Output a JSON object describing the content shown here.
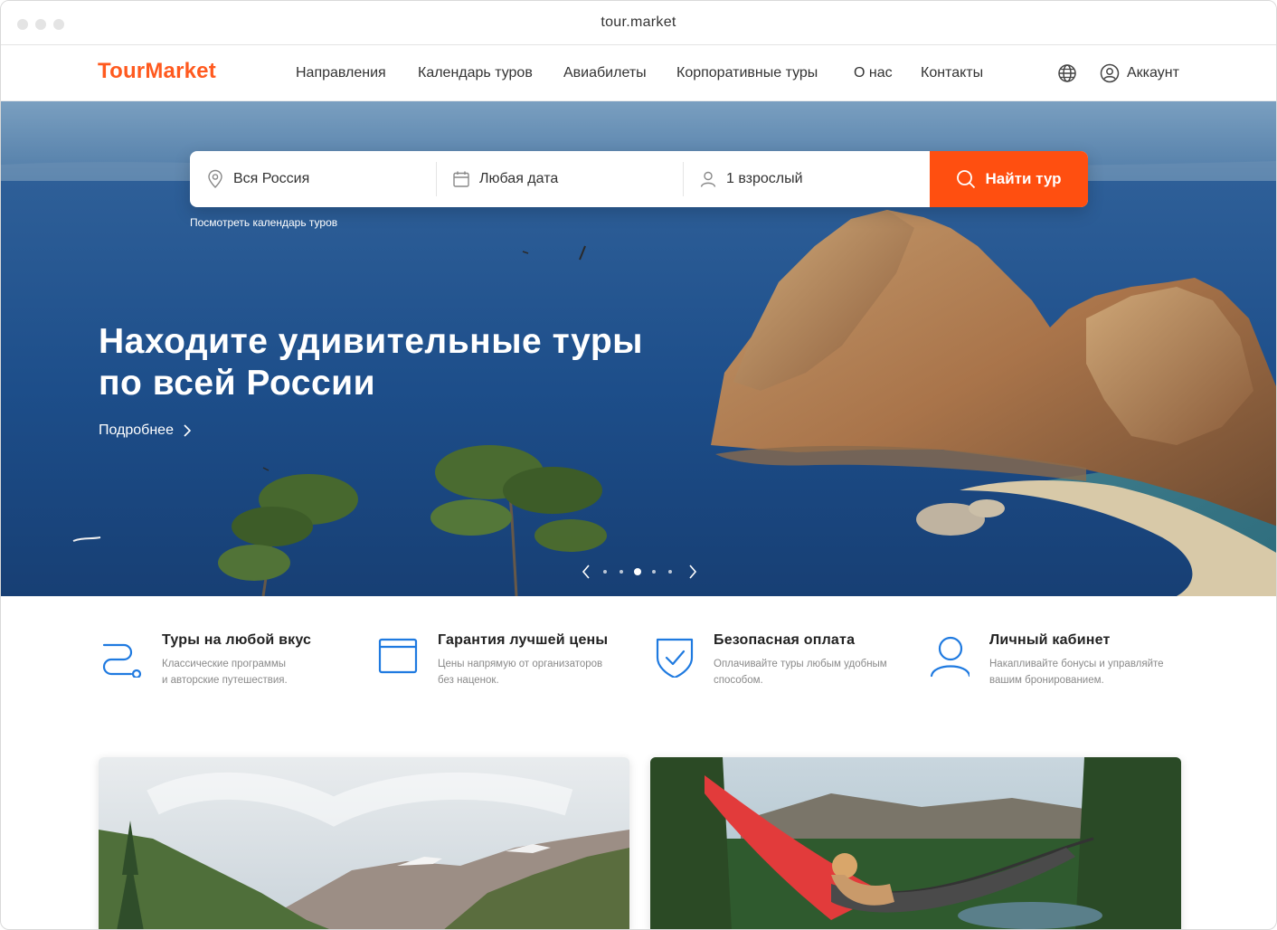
{
  "browser": {
    "url": "tour.market"
  },
  "nav": {
    "logo": "TourMarket",
    "links": [
      "Направления",
      "Календарь туров",
      "Авиабилеты",
      "Корпоративные туры",
      "О нас",
      "Контакты"
    ],
    "account_label": "Аккаунт"
  },
  "search": {
    "destination": "Вся Россия",
    "date": "Любая дата",
    "travelers": "1 взрослый",
    "button_label": "Найти тур",
    "calendar_link": "Посмотреть календарь туров"
  },
  "hero": {
    "title_line1": "Находите удивительные туры",
    "title_line2": "по всей России",
    "more_label": "Подробнее",
    "carousel_total": 5,
    "carousel_active": 3
  },
  "features": [
    {
      "title": "Туры на любой вкус",
      "desc_line1": "Классические программы",
      "desc_line2": "и авторские путешествия.",
      "icon": "route-icon"
    },
    {
      "title": "Гарантия лучшей цены",
      "desc_line1": "Цены напрямую от организаторов",
      "desc_line2": "без наценок.",
      "icon": "folder-icon"
    },
    {
      "title": "Безопасная оплата",
      "desc_line1": "Оплачивайте туры любым удобным",
      "desc_line2": "способом.",
      "icon": "shield-check-icon"
    },
    {
      "title": "Личный кабинет",
      "desc_line1": "Накапливайте бонусы и управляйте",
      "desc_line2": "вашим бронированием.",
      "icon": "user-icon"
    }
  ],
  "colors": {
    "accent": "#ff5a1f",
    "button": "#ff4f10",
    "feature_icon": "#1f7ae0"
  }
}
